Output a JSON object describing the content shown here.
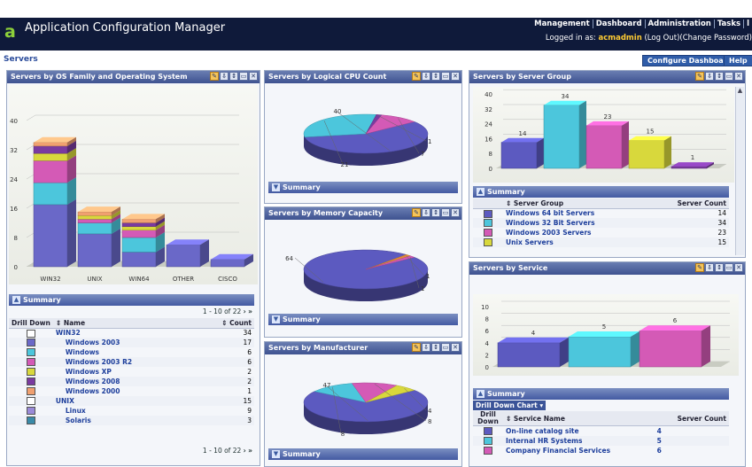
{
  "app": {
    "title": "Application Configuration Manager",
    "logo_letter": "a"
  },
  "topnav": {
    "items": [
      "Management",
      "Dashboard",
      "Administration",
      "Tasks"
    ]
  },
  "login": {
    "prefix": "Logged in as:",
    "user": "acmadmin",
    "logout": "(Log Out)",
    "change_password": "(Change Password)"
  },
  "breadcrumb": "Servers",
  "buttons": {
    "configure": "Configure Dashboard",
    "help": "Help"
  },
  "panels": {
    "os": {
      "title": "Servers by OS Family and Operating System"
    },
    "cpu": {
      "title": "Servers by Logical CPU Count"
    },
    "memory": {
      "title": "Servers by Memory Capacity"
    },
    "manufacturer": {
      "title": "Servers by Manufacturer"
    },
    "group": {
      "title": "Servers by Server Group"
    },
    "service": {
      "title": "Servers by Service"
    }
  },
  "summary_label": "Summary",
  "os_table": {
    "pager": "1 - 10 of 22",
    "headers": [
      "Drill Down",
      "Name",
      "Count"
    ],
    "rows": [
      {
        "name": "WIN32",
        "count": "34",
        "color": "#ffffff",
        "indent": false
      },
      {
        "name": "Windows 2003",
        "count": "17",
        "color": "#6a68c8",
        "indent": true
      },
      {
        "name": "Windows",
        "count": "6",
        "color": "#4cc6dc",
        "indent": true
      },
      {
        "name": "Windows 2003 R2",
        "count": "6",
        "color": "#d45ab6",
        "indent": true
      },
      {
        "name": "Windows XP",
        "count": "2",
        "color": "#d8d83c",
        "indent": true
      },
      {
        "name": "Windows 2008",
        "count": "2",
        "color": "#7a3aa0",
        "indent": true
      },
      {
        "name": "Windows 2000",
        "count": "1",
        "color": "#f0a070",
        "indent": true
      },
      {
        "name": "UNIX",
        "count": "15",
        "color": "#ffffff",
        "indent": false
      },
      {
        "name": "Linux",
        "count": "9",
        "color": "#9a8ad8",
        "indent": true
      },
      {
        "name": "Solaris",
        "count": "3",
        "color": "#3a8aa8",
        "indent": true
      }
    ]
  },
  "group_table": {
    "headers": [
      "Server Group",
      "Server Count"
    ],
    "rows": [
      {
        "name": "Windows 64 bit Servers",
        "count": "14",
        "color": "#5c5ac0"
      },
      {
        "name": "Windows 32 Bit Servers",
        "count": "34",
        "color": "#4cc6dc"
      },
      {
        "name": "Windows 2003 Servers",
        "count": "23",
        "color": "#d45ab6"
      },
      {
        "name": "Unix Servers",
        "count": "15",
        "color": "#d8d83c"
      }
    ]
  },
  "service_table": {
    "drill_label": "Drill Down Chart",
    "headers": [
      "Drill Down",
      "Service Name",
      "Server Count"
    ],
    "rows": [
      {
        "name": "On-line catalog site",
        "count": "4",
        "color": "#5c5ac0"
      },
      {
        "name": "Internal HR Systems",
        "count": "5",
        "color": "#4cc6dc"
      },
      {
        "name": "Company Financial Services",
        "count": "6",
        "color": "#d45ab6"
      }
    ]
  },
  "chart_data": [
    {
      "type": "bar",
      "title": "Servers by OS Family and Operating System",
      "categories": [
        "WIN32",
        "UNIX",
        "WIN64",
        "OTHER",
        "CISCO"
      ],
      "stacked": true,
      "ylim": [
        0,
        40
      ],
      "yticks": [
        "0",
        "8",
        "16",
        "24",
        "32",
        "40"
      ],
      "series": [
        {
          "values": [
            17,
            9,
            4,
            6,
            2
          ],
          "color": "#6a68c8"
        },
        {
          "values": [
            6,
            3,
            4,
            0,
            0
          ],
          "color": "#4cc6dc"
        },
        {
          "values": [
            6,
            1,
            2,
            0,
            0
          ],
          "color": "#d45ab6"
        },
        {
          "values": [
            2,
            1,
            1,
            0,
            0
          ],
          "color": "#d8d83c"
        },
        {
          "values": [
            2,
            0,
            1,
            0,
            0
          ],
          "color": "#7a3aa0"
        },
        {
          "values": [
            1,
            1,
            1,
            0,
            0
          ],
          "color": "#f0a070"
        }
      ]
    },
    {
      "type": "pie",
      "title": "Servers by Logical CPU Count",
      "labels": [
        "40",
        "21",
        "1",
        "7"
      ],
      "values": [
        40,
        21,
        1,
        7
      ],
      "colors": [
        "#5c5ac0",
        "#4cc6dc",
        "#7a3aa0",
        "#d45ab6"
      ]
    },
    {
      "type": "pie",
      "title": "Servers by Memory Capacity",
      "labels": [
        "64",
        "1",
        "1"
      ],
      "values": [
        64,
        1,
        1
      ],
      "colors": [
        "#5c5ac0",
        "#e08a3a",
        "#d45ab6"
      ]
    },
    {
      "type": "pie",
      "title": "Servers by Manufacturer",
      "labels": [
        "47",
        "8",
        "8",
        "4"
      ],
      "values": [
        47,
        8,
        8,
        4
      ],
      "colors": [
        "#5c5ac0",
        "#4cc6dc",
        "#d45ab6",
        "#d8d83c"
      ]
    },
    {
      "type": "bar",
      "title": "Servers by Server Group",
      "categories": [
        "Windows 64 bit Servers",
        "Windows 32 Bit Servers",
        "Windows 2003 Servers",
        "Unix Servers",
        ""
      ],
      "values": [
        14,
        34,
        23,
        15,
        1
      ],
      "colors": [
        "#5c5ac0",
        "#4cc6dc",
        "#d45ab6",
        "#d8d83c",
        "#7a3aa0"
      ],
      "ylim": [
        0,
        40
      ],
      "yticks": [
        "0",
        "8",
        "16",
        "24",
        "32",
        "40"
      ]
    },
    {
      "type": "bar",
      "title": "Servers by Service",
      "categories": [
        "On-line catalog site",
        "Internal HR Systems",
        "Company Financial Services"
      ],
      "values": [
        4,
        5,
        6
      ],
      "colors": [
        "#5c5ac0",
        "#4cc6dc",
        "#d45ab6"
      ],
      "ylim": [
        0,
        10
      ],
      "yticks": [
        "0",
        "2",
        "4",
        "6",
        "8",
        "10"
      ]
    }
  ]
}
